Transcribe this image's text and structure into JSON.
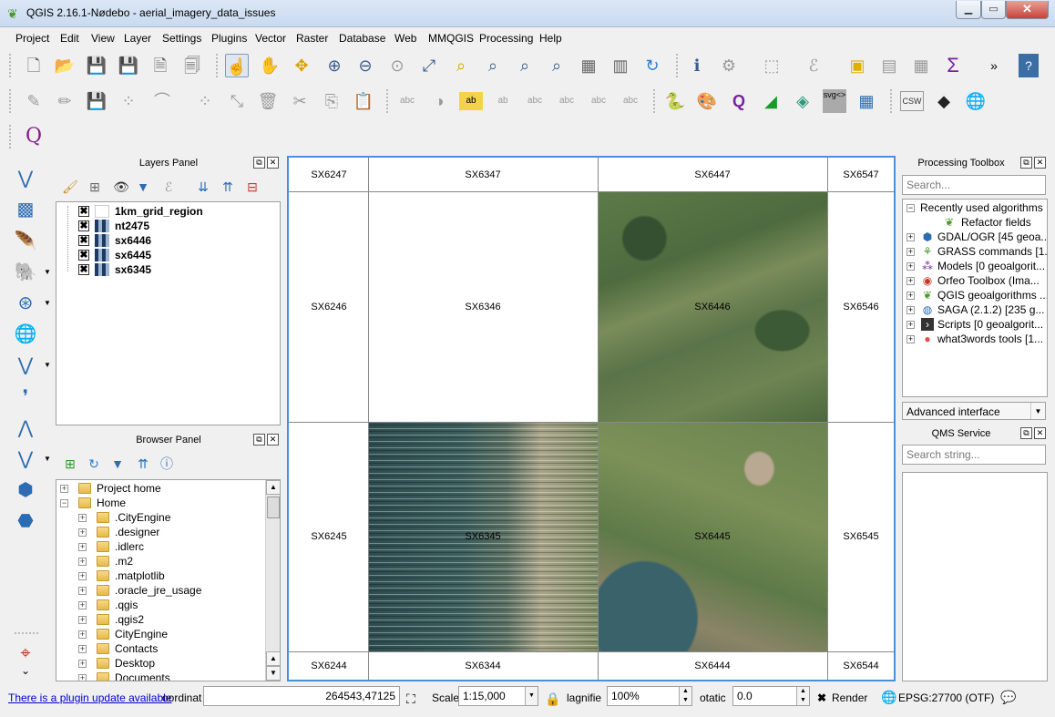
{
  "window": {
    "title": "QGIS 2.16.1-Nødebo - aerial_imagery_data_issues"
  },
  "menu": [
    "Project",
    "Edit",
    "View",
    "Layer",
    "Settings",
    "Plugins",
    "Vector",
    "Raster",
    "Database",
    "Web",
    "MMQGIS",
    "Processing",
    "Help"
  ],
  "toolbar3": {
    "qgis_cloud_label": "Q"
  },
  "layers_panel": {
    "title": "Layers Panel",
    "layers": [
      {
        "name": "1km_grid_region",
        "checked": "✖",
        "symbol": "polygon"
      },
      {
        "name": "nt2475",
        "checked": "✖",
        "symbol": "raster"
      },
      {
        "name": "sx6446",
        "checked": "✖",
        "symbol": "raster"
      },
      {
        "name": "sx6445",
        "checked": "✖",
        "symbol": "raster"
      },
      {
        "name": "sx6345",
        "checked": "✖",
        "symbol": "raster"
      }
    ]
  },
  "browser_panel": {
    "title": "Browser Panel",
    "items": [
      {
        "label": "Project home",
        "level": 0,
        "expander": "+"
      },
      {
        "label": "Home",
        "level": 0,
        "expander": "−"
      },
      {
        "label": ".CityEngine",
        "level": 1,
        "expander": "+"
      },
      {
        "label": ".designer",
        "level": 1,
        "expander": "+"
      },
      {
        "label": ".idlerc",
        "level": 1,
        "expander": "+"
      },
      {
        "label": ".m2",
        "level": 1,
        "expander": "+"
      },
      {
        "label": ".matplotlib",
        "level": 1,
        "expander": "+"
      },
      {
        "label": ".oracle_jre_usage",
        "level": 1,
        "expander": "+"
      },
      {
        "label": ".qgis",
        "level": 1,
        "expander": "+"
      },
      {
        "label": ".qgis2",
        "level": 1,
        "expander": "+"
      },
      {
        "label": "CityEngine",
        "level": 1,
        "expander": "+"
      },
      {
        "label": "Contacts",
        "level": 1,
        "expander": "+"
      },
      {
        "label": "Desktop",
        "level": 1,
        "expander": "+"
      },
      {
        "label": "Documents",
        "level": 1,
        "expander": "+"
      }
    ]
  },
  "map": {
    "grid_labels": {
      "r0": [
        "SX6247",
        "SX6347",
        "SX6447",
        "SX6547"
      ],
      "r1": [
        "SX6246",
        "SX6346",
        "SX6446",
        "SX6546"
      ],
      "r2": [
        "SX6245",
        "SX6345",
        "SX6445",
        "SX6545"
      ],
      "r3": [
        "SX6244",
        "SX6344",
        "SX6444",
        "SX6544"
      ]
    }
  },
  "processing_toolbox": {
    "title": "Processing Toolbox",
    "search_placeholder": "Search...",
    "items": [
      {
        "label": "Recently used algorithms",
        "expander": "−",
        "icon": ""
      },
      {
        "label": "Refactor fields",
        "expander": "",
        "icon": "qgis-icon"
      },
      {
        "label": "GDAL/OGR [45 geoa...",
        "expander": "+",
        "icon": "gdal-icon"
      },
      {
        "label": "GRASS commands [1...",
        "expander": "+",
        "icon": "grass-icon"
      },
      {
        "label": "Models [0 geoalgorit...",
        "expander": "+",
        "icon": "models-icon"
      },
      {
        "label": "Orfeo Toolbox (Ima...",
        "expander": "+",
        "icon": "orfeo-icon"
      },
      {
        "label": "QGIS geoalgorithms ...",
        "expander": "+",
        "icon": "qgis-icon"
      },
      {
        "label": "SAGA (2.1.2) [235 g...",
        "expander": "+",
        "icon": "saga-icon"
      },
      {
        "label": "Scripts [0 geoalgorit...",
        "expander": "+",
        "icon": "scripts-icon"
      },
      {
        "label": "what3words tools [1...",
        "expander": "+",
        "icon": "what3words-icon"
      }
    ],
    "interface_mode": "Advanced interface"
  },
  "qms_service": {
    "title": "QMS Service",
    "search_placeholder": "Search string..."
  },
  "statusbar": {
    "plugin_update_link": "There is a plugin update available",
    "coordinate_label": "oordinat",
    "coordinate_value": "264543,47125",
    "scale_label": "Scale",
    "scale_value": "1:15,000",
    "magnifier_label": "lagnifie",
    "magnifier_value": "100%",
    "rotation_label": "otatic",
    "rotation_value": "0.0",
    "render_label": "Render",
    "render_checked": "✖",
    "crs": "EPSG:27700 (OTF)"
  },
  "colors": {
    "map_border": "#4a90d9",
    "link": "#0000cc"
  }
}
